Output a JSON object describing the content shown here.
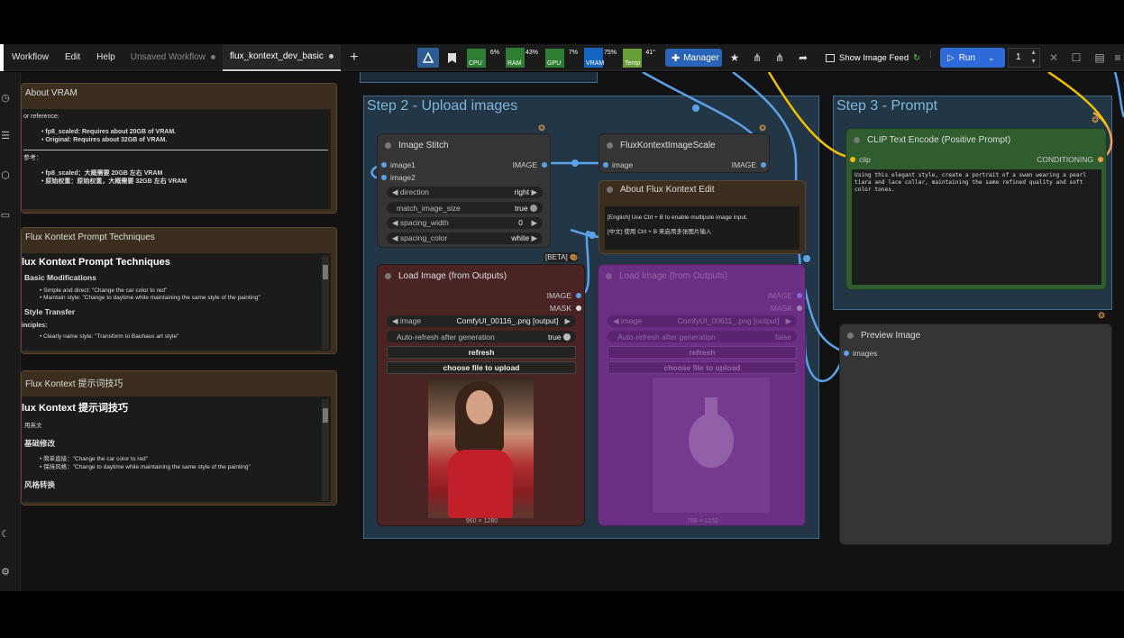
{
  "menu": {
    "workflow": "Workflow",
    "edit": "Edit",
    "help": "Help"
  },
  "tabs": [
    {
      "label": "Unsaved Workflow",
      "active": false
    },
    {
      "label": "flux_kontext_dev_basic",
      "active": true
    }
  ],
  "monitors": [
    {
      "label": "CPU",
      "pct": "6%",
      "color": "#2e7d32",
      "level": 0.06
    },
    {
      "label": "RAM",
      "pct": "43%",
      "color": "#2e7d32",
      "level": 0.43
    },
    {
      "label": "GPU",
      "pct": "7%",
      "color": "#2e7d32",
      "level": 0.07
    },
    {
      "label": "VRAM",
      "pct": "75%",
      "color": "#1565c0",
      "level": 0.75
    },
    {
      "label": "Temp",
      "pct": "41°",
      "color": "#689f38",
      "level": 0.41
    }
  ],
  "toolbar": {
    "manager": "Manager",
    "show_feed": "Show Image Feed",
    "run": "Run",
    "run_count": "1"
  },
  "notes": {
    "vram_title": "About VRAM",
    "vram_ref": "or reference:",
    "vram_l1": "fp8_scaled: Requires about 20GB of VRAM.",
    "vram_l2": "Original: Requires about 32GB of VRAM.",
    "vram_cn_head": "参考：",
    "vram_cn1": "fp8_scaled：大概需要 20GB 左右 VRAM",
    "vram_cn2": "原始权重：原始权重，大概需要 32GB 左右 VRAM",
    "tech_title": "Flux Kontext Prompt Techniques",
    "tech_h1": "lux Kontext Prompt Techniques",
    "tech_h2": "Basic Modifications",
    "tech_l1": "Simple and direct: \"Change the car color to red\"",
    "tech_l2": "Maintain style: \"Change to daytime while maintaining the same style of the painting\"",
    "tech_h3": "Style Transfer",
    "tech_h4": "inciples:",
    "tech_l3": "Clearly name style: \"Transform to Bauhaus art style\"",
    "cn_title": "Flux Kontext 提示词技巧",
    "cn_h1": "lux Kontext 提示词技巧",
    "cn_sub": "用英文",
    "cn_h2": "基础修改",
    "cn_l1": "简单直接：\"Change the car color to red\"",
    "cn_l2": "保持风格：\"Change to daytime while maintaining the same style of the painting\"",
    "cn_h3": "风格转换"
  },
  "groups": {
    "step2": "Step 2 - Upload images",
    "step3": "Step 3 - Prompt"
  },
  "stitch": {
    "title": "Image Stitch",
    "in1": "image1",
    "in2": "image2",
    "out": "IMAGE",
    "w_direction": "direction",
    "v_direction": "right",
    "w_match": "match_image_size",
    "v_match": "true",
    "w_spacing": "spacing_width",
    "v_spacing": "0",
    "w_color": "spacing_color",
    "v_color": "white"
  },
  "scale": {
    "title": "FluxKontextImageScale",
    "in": "image",
    "out": "IMAGE"
  },
  "about": {
    "title": "About Flux Kontext Edit",
    "l1": "[English] Use Ctrl + B to enable multipule image input.",
    "l2": "[中文] 使用 Ctrl + B 来启用多张图片输入"
  },
  "beta": "[BETA]",
  "load1": {
    "title": "Load Image (from Outputs)",
    "out1": "IMAGE",
    "out2": "MASK",
    "w_image": "image",
    "v_image": "ComfyUI_00116_.png [output]",
    "w_auto": "Auto-refresh after generation",
    "v_auto": "true",
    "refresh": "refresh",
    "choose": "choose file to upload",
    "size": "960 × 1280"
  },
  "load2": {
    "title": "Load Image (from Outputs)",
    "out1": "IMAGE",
    "out2": "MASK",
    "w_image": "image",
    "v_image": "ComfyUI_00611_.png [output]",
    "w_auto": "Auto-refresh after generation",
    "v_auto": "false",
    "refresh": "refresh",
    "choose": "choose file to upload",
    "size": "768 × 1152"
  },
  "clip": {
    "title": "CLIP Text Encode (Positive Prompt)",
    "in": "clip",
    "out": "CONDITIONING",
    "text": "Using this elegant style, create a portrait of a swan wearing a pearl tiara and lace collar, maintaining the same refined quality and soft color tones."
  },
  "preview": {
    "title": "Preview Image",
    "in": "images"
  },
  "colors": {
    "note_header": "#3b2e1f",
    "note_border": "#5a4630",
    "node_body": "#353535",
    "group": "#325470",
    "clip_green": "#2f5d2f",
    "purple": "#6e2e86",
    "accent": "#2f6bd8"
  }
}
